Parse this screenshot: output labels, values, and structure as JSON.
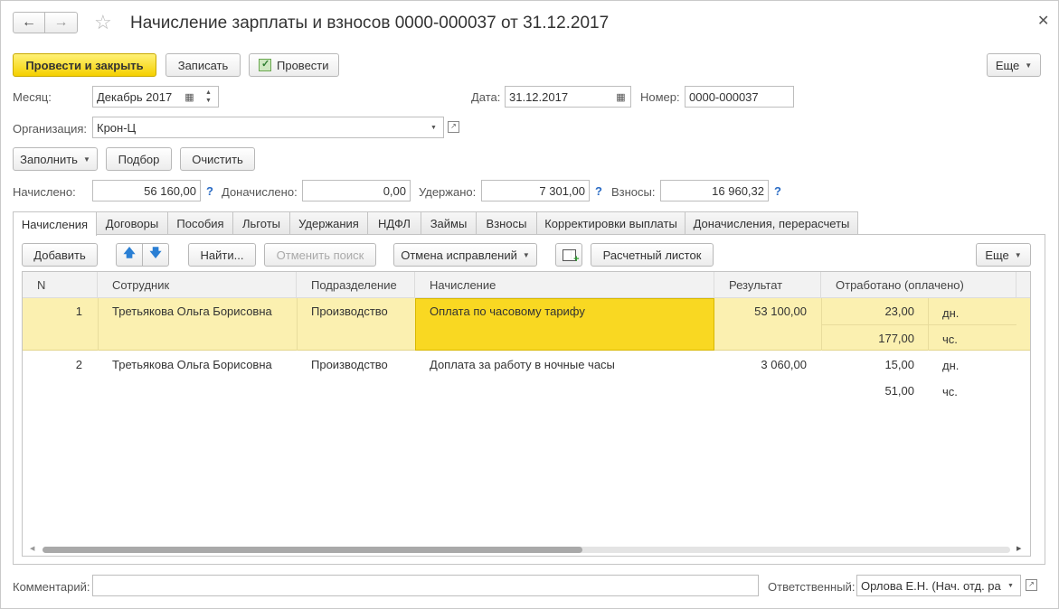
{
  "title": "Начисление зарплаты и взносов 0000-000037 от 31.12.2017",
  "toolbar": {
    "post_close": "Провести и закрыть",
    "save": "Записать",
    "post": "Провести",
    "more": "Еще"
  },
  "header": {
    "month_label": "Месяц:",
    "month_value": "Декабрь 2017",
    "date_label": "Дата:",
    "date_value": "31.12.2017",
    "number_label": "Номер:",
    "number_value": "0000-000037",
    "org_label": "Организация:",
    "org_value": "Крон-Ц"
  },
  "actions": {
    "fill": "Заполнить",
    "pick": "Подбор",
    "clear": "Очистить"
  },
  "totals": {
    "accrued_label": "Начислено:",
    "accrued_value": "56 160,00",
    "extra_label": "Доначислено:",
    "extra_value": "0,00",
    "withheld_label": "Удержано:",
    "withheld_value": "7 301,00",
    "contrib_label": "Взносы:",
    "contrib_value": "16 960,32",
    "help": "?"
  },
  "tabs": [
    "Начисления",
    "Договоры",
    "Пособия",
    "Льготы",
    "Удержания",
    "НДФЛ",
    "Займы",
    "Взносы",
    "Корректировки выплаты",
    "Доначисления, перерасчеты"
  ],
  "table_toolbar": {
    "add": "Добавить",
    "find": "Найти...",
    "cancel_search": "Отменить поиск",
    "cancel_fix": "Отмена исправлений",
    "payslip": "Расчетный листок",
    "more": "Еще"
  },
  "columns": [
    "N",
    "Сотрудник",
    "Подразделение",
    "Начисление",
    "Результат",
    "Отработано (оплачено)"
  ],
  "rows": [
    {
      "n": "1",
      "employee": "Третьякова Ольга Борисовна",
      "dept": "Производство",
      "accrual": "Оплата по часовому тарифу",
      "result": "53 100,00",
      "days": "23,00",
      "days_unit": "дн.",
      "hours": "177,00",
      "hours_unit": "чс."
    },
    {
      "n": "2",
      "employee": "Третьякова Ольга Борисовна",
      "dept": "Производство",
      "accrual": "Доплата за работу в ночные часы",
      "result": "3 060,00",
      "days": "15,00",
      "days_unit": "дн.",
      "hours": "51,00",
      "hours_unit": "чс."
    }
  ],
  "footer": {
    "comment_label": "Комментарий:",
    "comment_value": "",
    "responsible_label": "Ответственный:",
    "responsible_value": "Орлова Е.Н. (Нач. отд. ра"
  },
  "colors": {
    "primary_button": "#f5d000",
    "selected_row": "#fbf0b0",
    "selected_cell": "#f9d822",
    "link": "#2a6bc4"
  },
  "icons": [
    "back-arrow-icon",
    "forward-arrow-icon",
    "star-icon",
    "close-icon",
    "post-icon",
    "calendar-icon",
    "spin-icon",
    "dropdown-icon",
    "open-icon",
    "arrow-up-icon",
    "arrow-down-icon",
    "table-settings-icon"
  ]
}
